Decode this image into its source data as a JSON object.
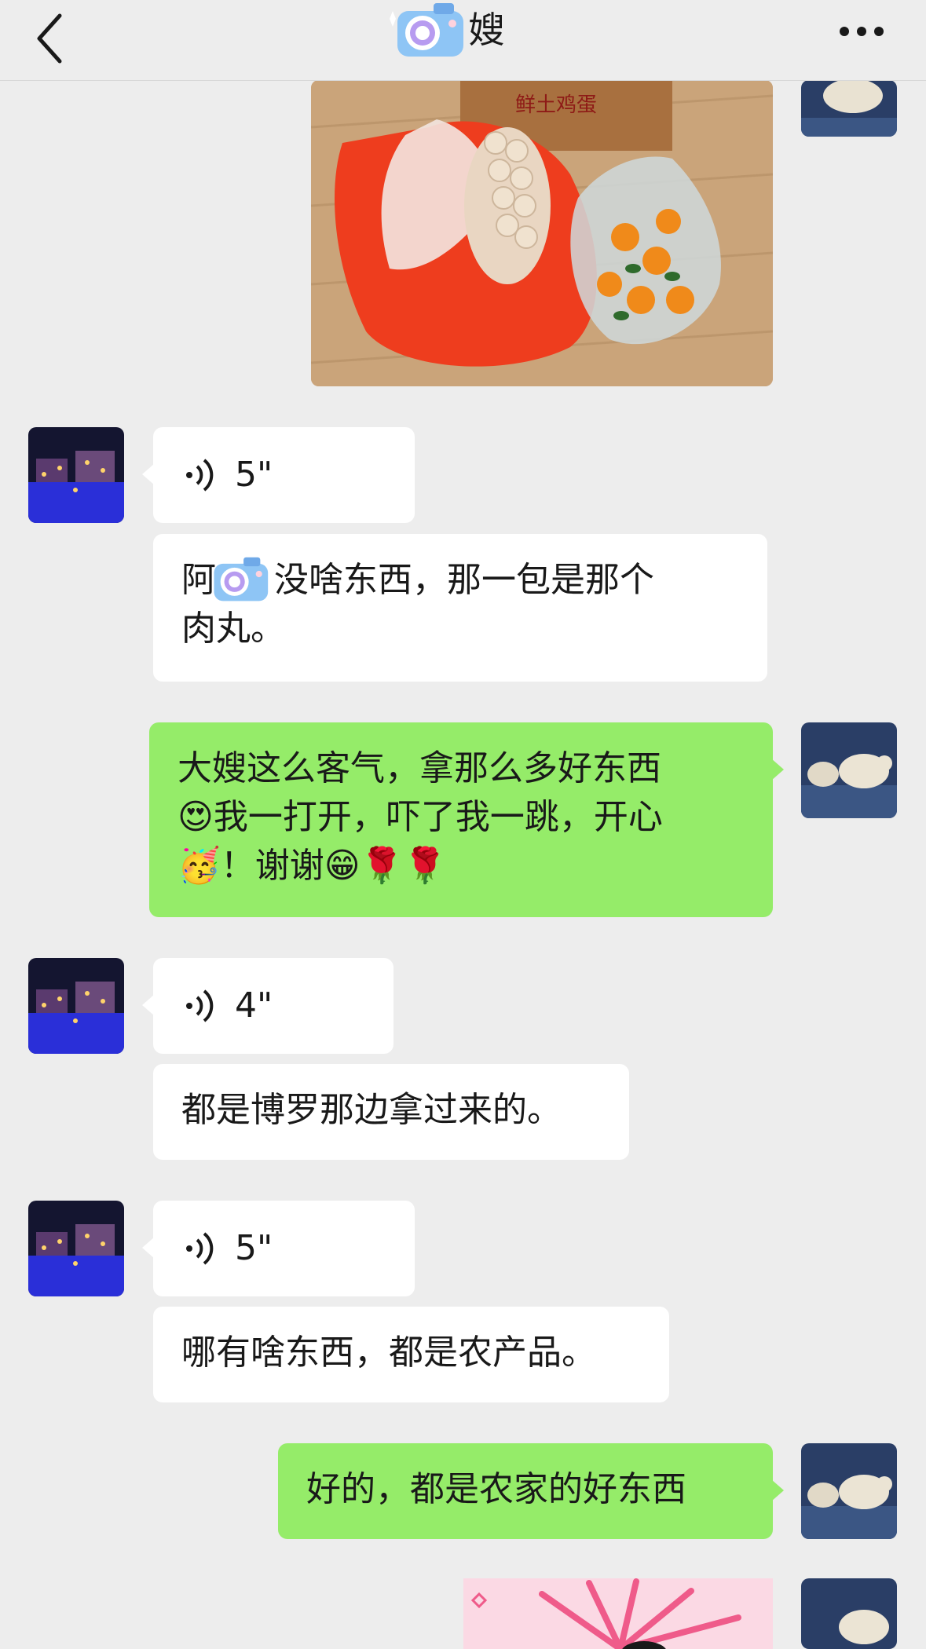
{
  "header": {
    "title": "嫂",
    "back_icon": "chevron-left-icon",
    "more_icon": "more-dots-icon"
  },
  "messages": [
    {
      "side": "out",
      "type": "image",
      "content": "photo of a red bag, a white bag of meatballs, oranges and a box labeled 鲜土鸡蛋"
    },
    {
      "side": "in",
      "type": "voice",
      "duration": "5\""
    },
    {
      "side": "in",
      "type": "text",
      "line1": "阿",
      "line1b": "没啥东西，那一包是那个",
      "line2": "肉丸。"
    },
    {
      "side": "out",
      "type": "text",
      "line1": "大嫂这么客气，拿那么多好东西",
      "line2": "我一打开，吓了我一跳，开心",
      "line3": "！谢谢"
    },
    {
      "side": "in",
      "type": "voice",
      "duration": "4\""
    },
    {
      "side": "in",
      "type": "text",
      "text": "都是博罗那边拿过来的。"
    },
    {
      "side": "in",
      "type": "voice",
      "duration": "5\""
    },
    {
      "side": "in",
      "type": "text",
      "text": "哪有啥东西，都是农产品。"
    },
    {
      "side": "out",
      "type": "text",
      "text": "好的，都是农家的好东西"
    },
    {
      "side": "out",
      "type": "sticker"
    }
  ],
  "photo_box_text": "鲜土鸡蛋",
  "colors": {
    "background": "#ededed",
    "incoming_bubble": "#ffffff",
    "outgoing_bubble": "#95ec69"
  }
}
